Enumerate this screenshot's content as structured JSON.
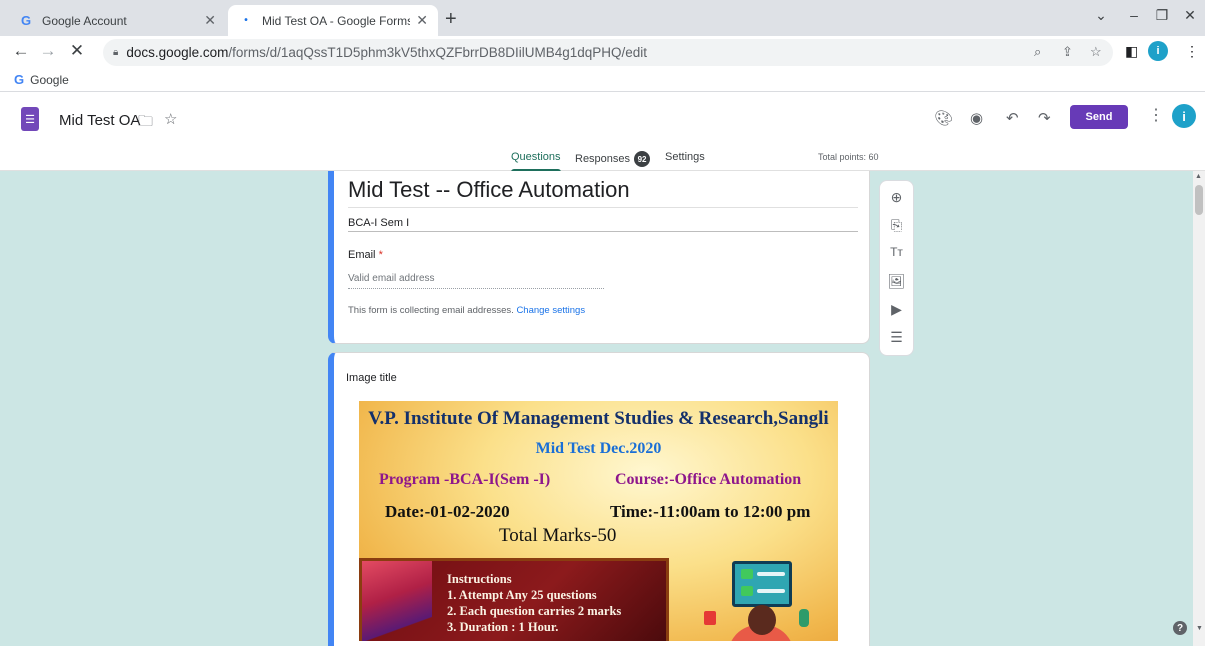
{
  "browser": {
    "tabs": [
      {
        "title": "Google Account",
        "favicon": "G",
        "active": false
      },
      {
        "title": "Mid Test OA - Google Forms",
        "favicon": "loading-dot",
        "active": true
      }
    ],
    "new_tab_glyph": "+",
    "url_host": "docs.google.com",
    "url_path": "/forms/d/1aqQssT1D5phm3kV5thxQZFbrrDB8DIilUMB4g1dqPHQ/edit",
    "profile_initial": "i",
    "bookmark": {
      "favicon": "G",
      "label": "Google"
    }
  },
  "forms": {
    "doc_title": "Mid Test OA",
    "send_label": "Send",
    "user_initial": "i",
    "tabs": [
      {
        "label": "Questions",
        "active": true
      },
      {
        "label": "Responses",
        "active": false,
        "badge": "92"
      },
      {
        "label": "Settings",
        "active": false
      }
    ],
    "total_points": "Total points: 60",
    "accent_color": "#673ab7",
    "background_color": "#cce6e4"
  },
  "header_card": {
    "title": "Mid Test --  Office Automation",
    "description": "BCA-I Sem I",
    "email_label": "Email",
    "required_mark": "*",
    "email_placeholder": "Valid email address",
    "collecting_note": "This form is collecting email addresses.",
    "change_settings_link": "Change settings"
  },
  "side_toolbar": [
    "add-question-icon",
    "import-questions-icon",
    "add-title-icon",
    "add-image-icon",
    "add-video-icon",
    "add-section-icon"
  ],
  "image_card": {
    "title": "Image title",
    "banner": {
      "institute": "V.P. Institute Of Management Studies & Research,Sangli",
      "exam": "Mid Test Dec.2020",
      "program": "Program -BCA-I(Sem -I)",
      "course": "Course:-Office Automation",
      "date": "Date:-01-02-2020",
      "time": "Time:-11:00am to 12:00 pm",
      "total_marks": "Total Marks-50",
      "instructions_heading": "Instructions",
      "instructions": [
        "1. Attempt Any 25 questions",
        "2. Each question carries 2 marks",
        "3. Duration : 1 Hour."
      ]
    }
  },
  "help_glyph": "?"
}
